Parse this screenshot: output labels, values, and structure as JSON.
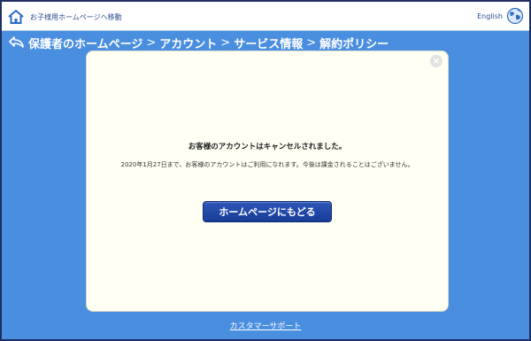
{
  "topbar": {
    "home_link_label": "お子様用ホームページへ移動",
    "language_label": "English"
  },
  "breadcrumb": {
    "items": [
      "保護者のホームページ",
      "アカウント",
      "サービス情報",
      "解約ポリシー"
    ],
    "separator": ">"
  },
  "dialog": {
    "close_symbol": "×",
    "title": "お客様のアカウントはキャンセルされました。",
    "body": "2020年1月27日まで、お客様のアカウントはご利用になれます。今後は課金されることはございません。",
    "button_label": "ホームページにもどる"
  },
  "footer": {
    "support_link": "カスタマーサポート"
  },
  "colors": {
    "page_background": "#4a8ee0",
    "topbar_background": "#ffffff",
    "dialog_background": "#fffff3",
    "button_background": "#1f47a6",
    "frame_border": "#1f2f63"
  },
  "icons": {
    "home": "home-icon",
    "globe": "globe-icon",
    "back": "back-arrow-icon",
    "close": "close-icon"
  }
}
